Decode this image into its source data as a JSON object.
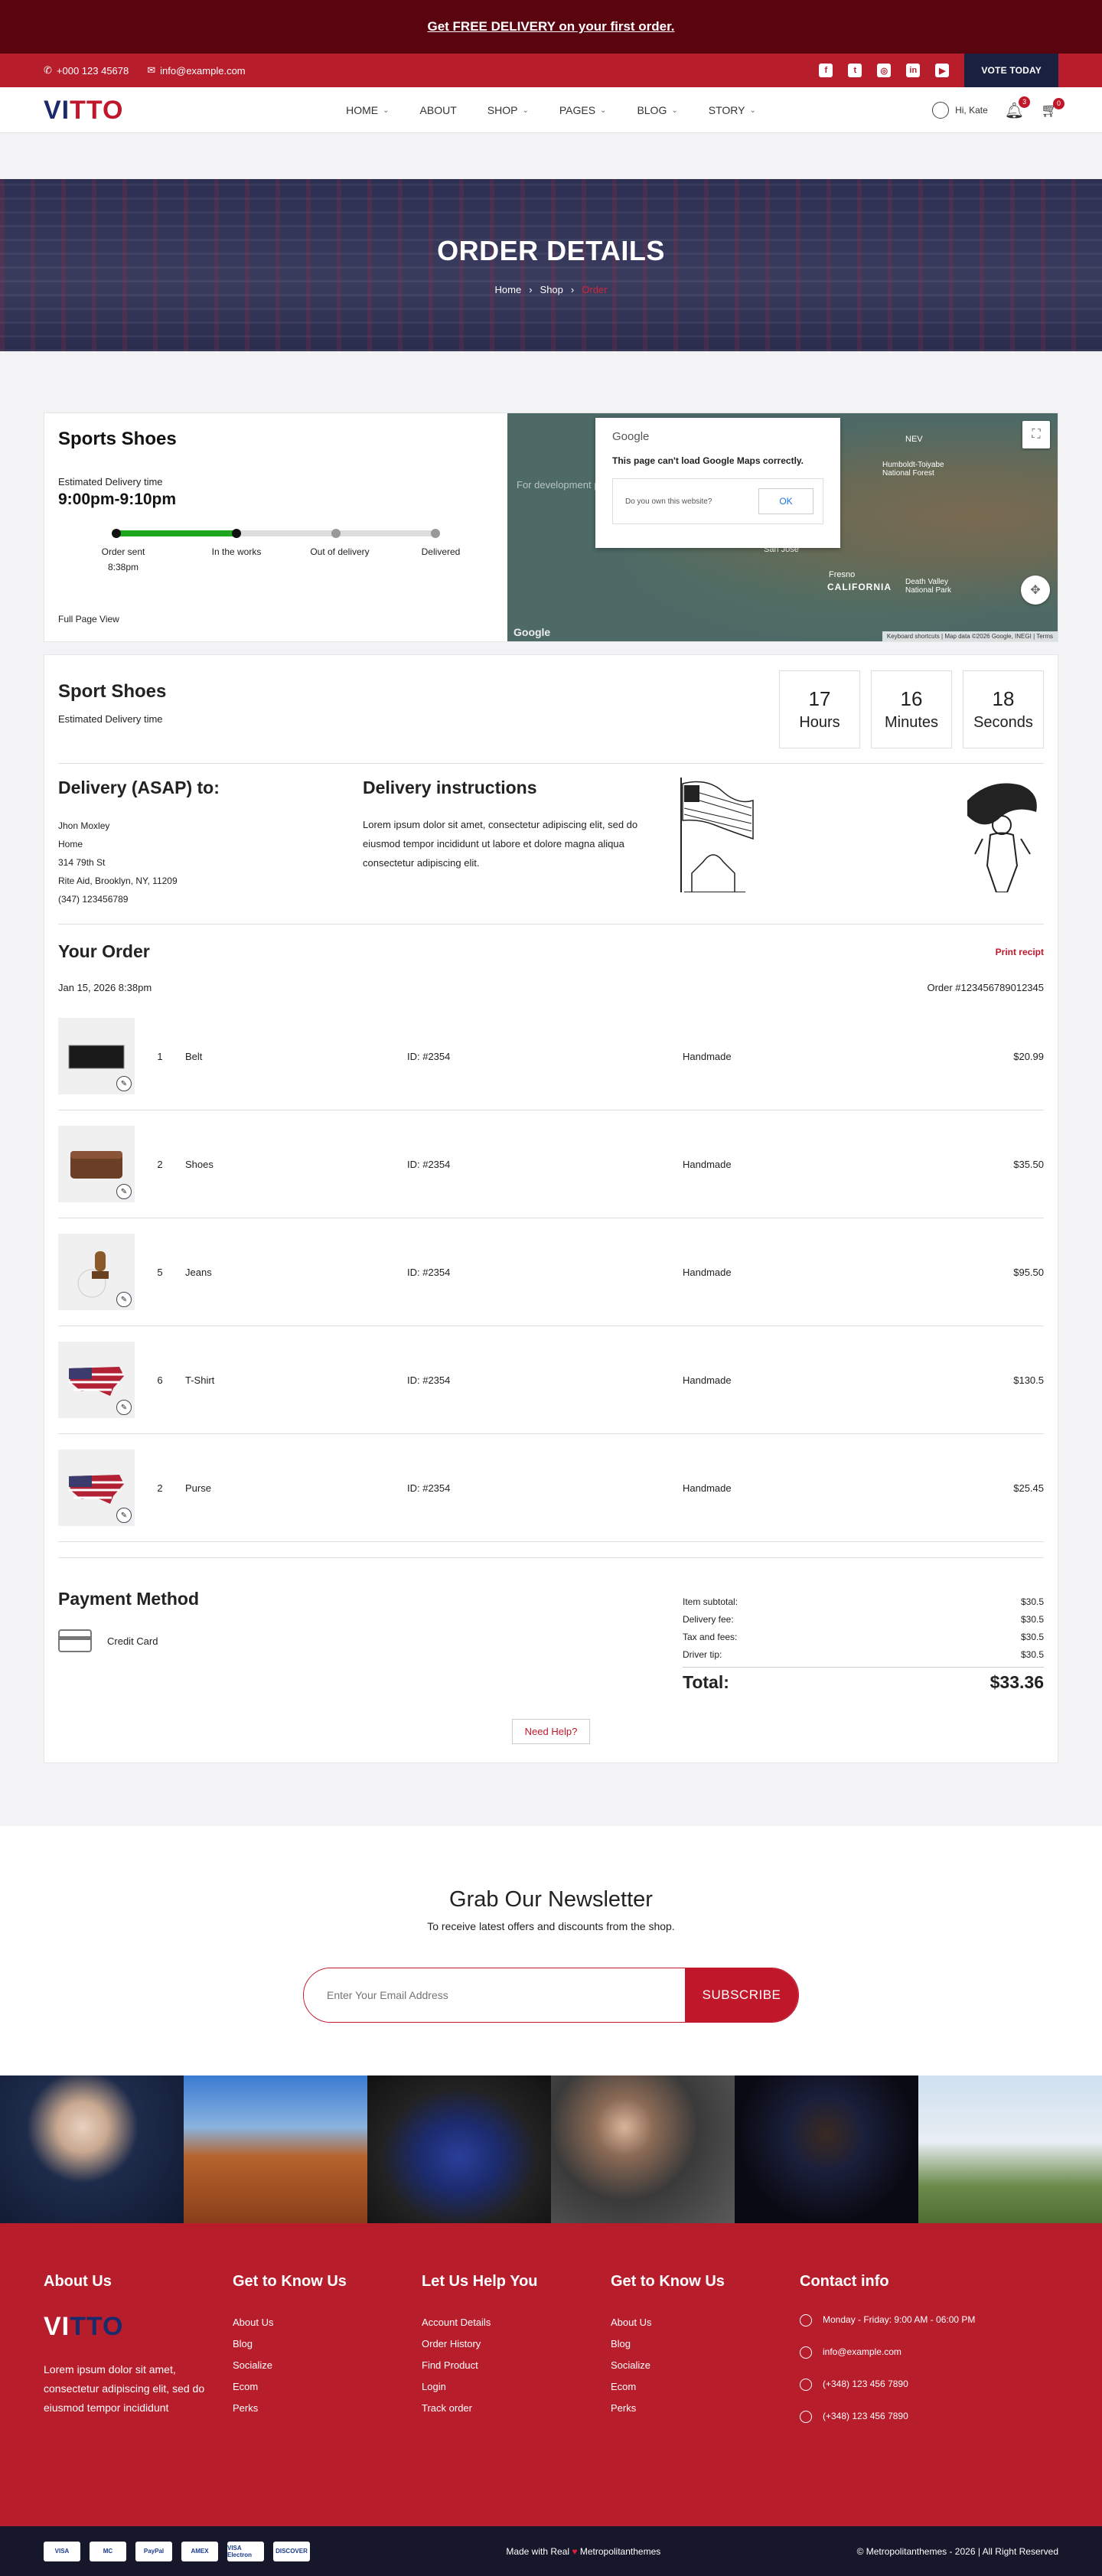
{
  "promo": {
    "text": "Get FREE DELIVERY on your first order."
  },
  "topbar": {
    "phone": "+000 123 45678",
    "email": "info@example.com",
    "social": [
      "facebook-icon",
      "twitter-icon",
      "instagram-icon",
      "linkedin-icon",
      "youtube-icon"
    ],
    "vote": "VOTE TODAY"
  },
  "header": {
    "logo_a": "VI",
    "logo_b": "TTO",
    "nav": [
      "HOME",
      "ABOUT",
      "SHOP",
      "PAGES",
      "BLOG",
      "STORY"
    ],
    "user": "Hi, Kate",
    "notif_count": "3",
    "cart_count": "0"
  },
  "hero": {
    "title": "ORDER DETAILS",
    "crumb": [
      "Home",
      "Shop",
      "Order"
    ]
  },
  "tracking": {
    "title": "Sports Shoes",
    "eta_label": "Estimated Delivery time",
    "eta": "9:00pm-9:10pm",
    "progress_fraction": 0.38,
    "steps": [
      "Order sent 8:38pm",
      "In the works",
      "Out of delivery",
      "Delivered"
    ],
    "full_view": "Full Page View",
    "map": {
      "google": "Google",
      "message": "This page can't load Google Maps correctly.",
      "own": "Do you own this website?",
      "ok": "OK",
      "dev_text": "For development purposes only",
      "labels": [
        "NEV",
        "Humboldt-Toiyabe National Forest",
        "San Jose",
        "Fresno",
        "CALIFORNIA",
        "Death Valley National Park"
      ],
      "footer": "Keyboard shortcuts  |  Map data ©2026 Google, INEGI  |  Terms"
    }
  },
  "order": {
    "title": "Sport Shoes",
    "eta_label": "Estimated Delivery time",
    "countdown": [
      {
        "n": "17",
        "u": "Hours"
      },
      {
        "n": "16",
        "u": "Minutes"
      },
      {
        "n": "18",
        "u": "Seconds"
      }
    ],
    "delivery_title": "Delivery (ASAP) to:",
    "address": [
      "Jhon Moxley",
      "Home",
      "314 79th St",
      "Rite Aid, Brooklyn, NY, 11209",
      "(347) 123456789"
    ],
    "instr_title": "Delivery instructions",
    "instr": "Lorem ipsum dolor sit amet, consectetur adipiscing elit, sed do eiusmod tempor incididunt ut labore et dolore magna aliqua consectetur adipiscing elit.",
    "your_order": "Your Order",
    "print": "Print recipt",
    "date": "Jan 15, 2026 8:38pm",
    "number": "Order #123456789012345",
    "items": [
      {
        "qty": "1",
        "name": "Belt",
        "id": "ID: #2354",
        "type": "Handmade",
        "price": "$20.99",
        "img": "belt"
      },
      {
        "qty": "2",
        "name": "Shoes",
        "id": "ID: #2354",
        "type": "Handmade",
        "price": "$35.50",
        "img": "wallet"
      },
      {
        "qty": "5",
        "name": "Jeans",
        "id": "ID: #2354",
        "type": "Handmade",
        "price": "$95.50",
        "img": "stamp"
      },
      {
        "qty": "6",
        "name": "T-Shirt",
        "id": "ID: #2354",
        "type": "Handmade",
        "price": "$130.5",
        "img": "usmap"
      },
      {
        "qty": "2",
        "name": "Purse",
        "id": "ID: #2354",
        "type": "Handmade",
        "price": "$25.45",
        "img": "usmap"
      }
    ],
    "payment_title": "Payment Method",
    "payment": "Credit Card",
    "summary": [
      {
        "l": "Item subtotal:",
        "v": "$30.5"
      },
      {
        "l": "Delivery fee:",
        "v": "$30.5"
      },
      {
        "l": "Tax and fees:",
        "v": "$30.5"
      },
      {
        "l": "Driver tip:",
        "v": "$30.5"
      }
    ],
    "total_label": "Total:",
    "total": "$33.36",
    "help": "Need Help?"
  },
  "newsletter": {
    "title": "Grab Our Newsletter",
    "sub": "To receive latest offers and discounts from the shop.",
    "placeholder": "Enter Your Email Address",
    "button": "SUBSCRIBE"
  },
  "footer": {
    "about_title": "About Us",
    "about_text": "Lorem ipsum dolor sit amet, consectetur adipiscing elit, sed do eiusmod tempor incididunt",
    "col1": {
      "title": "Get to Know Us",
      "links": [
        "About Us",
        "Blog",
        "Socialize",
        "Ecom",
        "Perks"
      ]
    },
    "col2": {
      "title": "Let Us Help You",
      "links": [
        "Account Details",
        "Order History",
        "Find Product",
        "Login",
        "Track order"
      ]
    },
    "col3": {
      "title": "Get to Know Us",
      "links": [
        "About Us",
        "Blog",
        "Socialize",
        "Ecom",
        "Perks"
      ]
    },
    "contact_title": "Contact info",
    "contact": [
      "Monday - Friday: 9:00 AM - 06:00 PM",
      "info@example.com",
      "(+348) 123 456 7890",
      "(+348) 123 456 7890"
    ],
    "payments": [
      "VISA",
      "MC",
      "PayPal",
      "AMEX",
      "VISA Electron",
      "DISCOVER"
    ],
    "made_a": "Made with Real",
    "made_b": "Metropolitanthemes",
    "copyright": "© Metropolitanthemes - 2026 | All Right Reserved"
  }
}
